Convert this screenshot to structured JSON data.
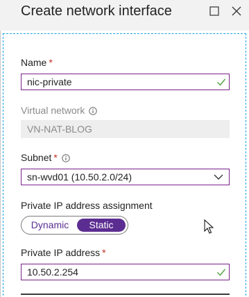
{
  "blade": {
    "title": "Create network interface",
    "maximize_icon": "maximize-icon",
    "close_icon": "close-icon"
  },
  "form": {
    "name": {
      "label": "Name",
      "required_mark": "*",
      "value": "nic-private",
      "valid_icon": "checkmark-icon"
    },
    "virtual_network": {
      "label": "Virtual network",
      "info_icon": "info-icon",
      "value": "VN-NAT-BLOG"
    },
    "subnet": {
      "label": "Subnet",
      "required_mark": "*",
      "info_icon": "info-icon",
      "value": "sn-wvd01 (10.50.2.0/24)",
      "dropdown_icon": "chevron-down-icon"
    },
    "ip_assignment": {
      "label": "Private IP address assignment",
      "options": [
        "Dynamic",
        "Static"
      ],
      "selected": "Static"
    },
    "private_ip": {
      "label": "Private IP address",
      "required_mark": "*",
      "value": "10.50.2.254",
      "valid_icon": "checkmark-icon"
    }
  },
  "colors": {
    "accent": "#5c2d91",
    "valid": "#57a64a",
    "required": "#c42b1c",
    "focus_border": "#7a1f8a",
    "dashed_frame": "#1ba1e2"
  },
  "cursor_icon": "mouse-pointer-icon"
}
